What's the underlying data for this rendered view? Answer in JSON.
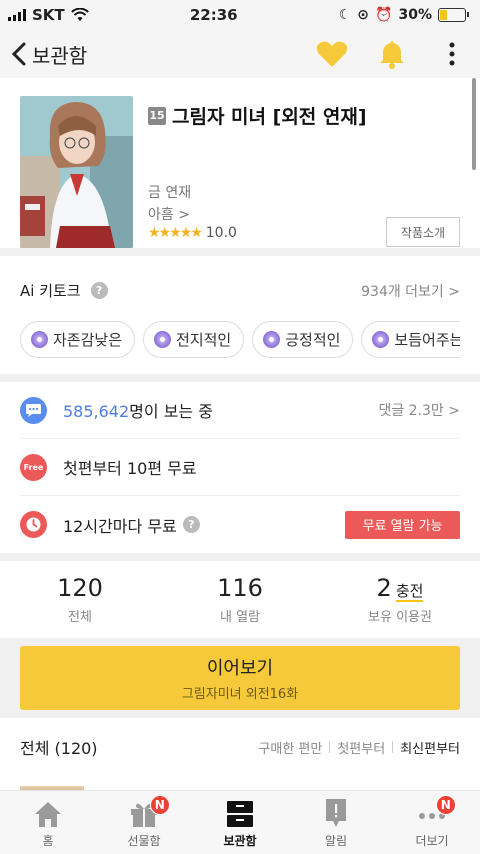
{
  "status_bar": {
    "carrier": "SKT",
    "time": "22:36",
    "battery": "30%",
    "battery_level": 0.3
  },
  "header": {
    "back_label": "보관함"
  },
  "work": {
    "age_rating": "15",
    "title": "그림자 미녀 [외전 연재]",
    "schedule": "금 연재",
    "author": "아흠 >",
    "stars": "★★★★★",
    "rating": "10.0",
    "intro_button": "작품소개"
  },
  "keytalk": {
    "title": "Ai 키토크",
    "help": "?",
    "more": "934개 더보기 >",
    "chips": [
      "자존감낮은",
      "전지적인",
      "긍정적인",
      "보듬어주는"
    ]
  },
  "stats": {
    "viewers_num": "585,642",
    "viewers_suffix": "명이 보는 중",
    "comments": "댓글 2.3만 >",
    "free_first": "첫편부터 10편 무료",
    "free_icon_label": "Free",
    "wait_free": "12시간마다 무료",
    "wait_help": "?",
    "free_button": "무료 열람 가능"
  },
  "counts": [
    {
      "value": "120",
      "label": "전체"
    },
    {
      "value": "116",
      "label": "내 열람"
    },
    {
      "value": "2",
      "label": "보유 이용권",
      "extra": "충전"
    }
  ],
  "continue": {
    "label": "이어보기",
    "sub": "그림자미녀 외전16화"
  },
  "list": {
    "title": "전체 (120)",
    "sort": [
      "구매한 편만",
      "첫편부터",
      "최신편부터"
    ]
  },
  "tabbar": [
    {
      "label": "홈"
    },
    {
      "label": "선물함",
      "badge": "N"
    },
    {
      "label": "보관함"
    },
    {
      "label": "알림"
    },
    {
      "label": "더보기",
      "badge": "N"
    }
  ],
  "colors": {
    "accent": "#f5c93a",
    "red": "#eb5a58",
    "blue": "#4d7de0"
  }
}
